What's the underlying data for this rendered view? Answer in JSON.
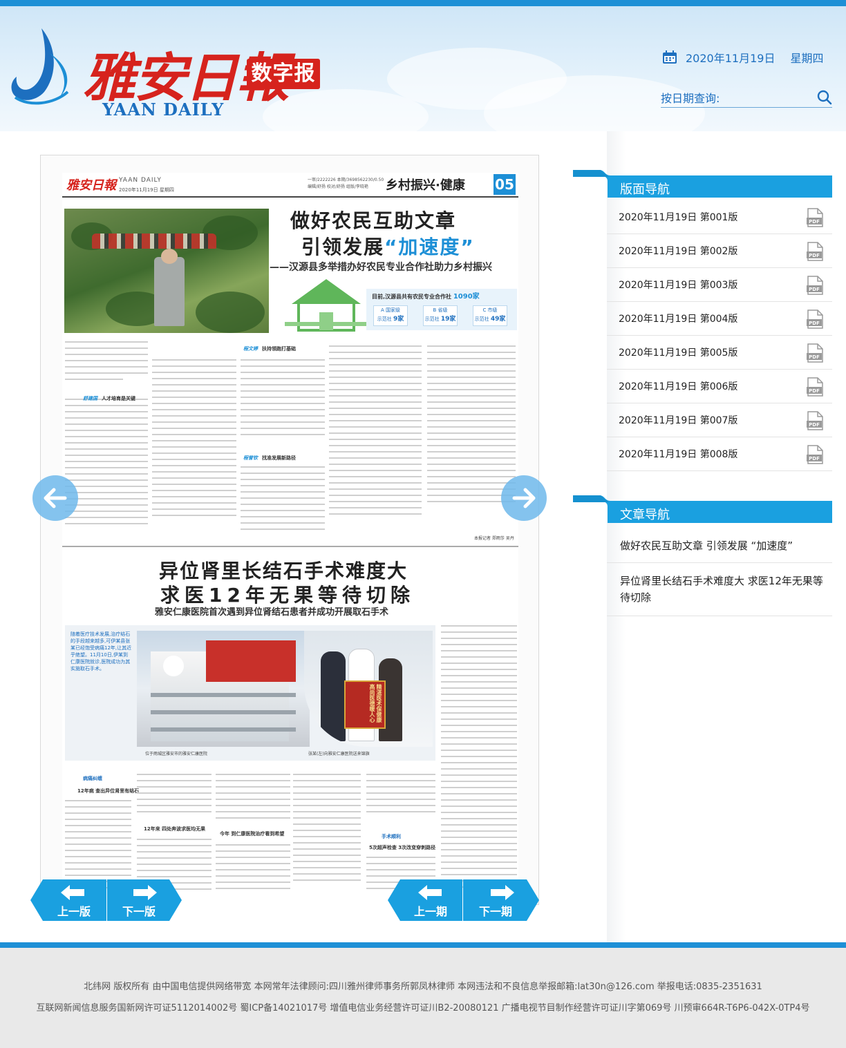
{
  "header": {
    "logo_cn": "雅安日報",
    "logo_badge": "数字报",
    "logo_en": "YAAN DAILY",
    "date": "2020年11月19日",
    "weekday": "星期四",
    "search_label": "按日期查询:",
    "accent_color": "#1d8fd6",
    "brand_red": "#d6231d"
  },
  "newspaper": {
    "masthead": "雅安日報",
    "masthead_en": "YAAN DAILY",
    "masthead_date": "2020年11月19日 星期四",
    "meta_line1": "一审/2222226 本期/3698562230/0.50",
    "meta_line2": "编辑/舒扬 校对/舒扬 组版/李晓艳",
    "section_title": "乡村振兴·健康",
    "page_number": "05",
    "article1": {
      "title_line1": "做好农民互助文章",
      "title_line2_prefix": "引领发展",
      "title_line2_highlight": "“加速度”",
      "subtitle": "——汉源县多举措办好农民专业合作社助力乡村振兴",
      "stats_title_prefix": "目前,汉源县共有农民专业合作社",
      "stats_total": "1090家",
      "stats": [
        {
          "grade": "A 国家级",
          "label": "示范社",
          "value": "9家"
        },
        {
          "grade": "B 省级",
          "label": "示范社",
          "value": "19家"
        },
        {
          "grade": "C 市级",
          "label": "示范社",
          "value": "49家"
        }
      ],
      "subheads": [
        {
          "tag": "舒建国",
          "text": "人才培育是关键"
        },
        {
          "tag": "程文婷",
          "text": "扶持领跑打基础"
        },
        {
          "tag": "程誉钦",
          "text": "找准发展新路径"
        }
      ],
      "byline": "本报记者 郑雨莎 吴丹"
    },
    "article2": {
      "title_line1": "异位肾里长结石手术难度大",
      "title_line2": "求医12年无果等待切除",
      "subtitle": "雅安仁康医院首次遇到异位肾结石患者并成功开展取石手术",
      "lead_text": "随着医疗技术发展,治疗结石的手段越来越多,可伊某县张某已经饱受病痛12年,让其近乎绝望。11月10日,伊某到仁康医院就诊,医院成功为其实施取石手术。",
      "banner_text": "精湛医术保健康 高尚医德暖人心",
      "caption_left": "位于雨城区雅安市的雅安仁康医院",
      "caption_right": "张某(左)向雅安仁康医院送来锦旗",
      "subheads": [
        "12年病 查出异位肾里有结石",
        "12年来 四处奔波求医均无果",
        "今年 到仁康医院治疗看到希望",
        "5次超声检查 3次改变穿刺路径"
      ],
      "section_tags": [
        "病痛纠缠",
        "手术顺利"
      ]
    }
  },
  "pager": {
    "prev_page": "上一版",
    "next_page": "下一版",
    "prev_issue": "上一期",
    "next_issue": "下一期"
  },
  "sidebar": {
    "page_nav_title": "版面导航",
    "pages": [
      {
        "label": "2020年11月19日 第001版",
        "icon": "pdf-icon"
      },
      {
        "label": "2020年11月19日 第002版",
        "icon": "pdf-icon"
      },
      {
        "label": "2020年11月19日 第003版",
        "icon": "pdf-icon"
      },
      {
        "label": "2020年11月19日 第004版",
        "icon": "pdf-icon"
      },
      {
        "label": "2020年11月19日 第005版",
        "icon": "pdf-icon"
      },
      {
        "label": "2020年11月19日 第006版",
        "icon": "pdf-icon"
      },
      {
        "label": "2020年11月19日 第007版",
        "icon": "pdf-icon"
      },
      {
        "label": "2020年11月19日 第008版",
        "icon": "pdf-icon"
      }
    ],
    "article_nav_title": "文章导航",
    "articles": [
      "做好农民互助文章 引领发展 “加速度”",
      "异位肾里长结石手术难度大 求医12年无果等待切除"
    ]
  },
  "footer": {
    "line1": "北纬网 版权所有 由中国电信提供网络带宽 本网常年法律顾问:四川雅州律师事务所郭凤林律师 本网违法和不良信息举报邮箱:lat30n@126.com 举报电话:0835-2351631",
    "line2": "互联网新闻信息服务国新网许可证5112014002号 蜀ICP备14021017号 增值电信业务经营许可证川B2-20080121 广播电视节目制作经营许可证川字第069号 川预审664R-T6P6-042X-0TP4号"
  }
}
